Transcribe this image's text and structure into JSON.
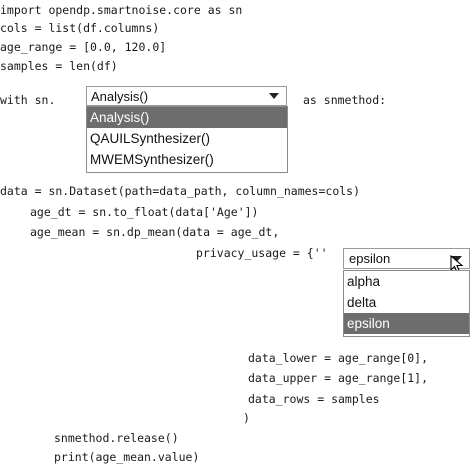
{
  "code": {
    "line1": "import opendp.smartnoise.core as sn",
    "line2": "cols = list(df.columns)",
    "line3": "age_range = [0.0, 120.0]",
    "line4": "samples = len(df)",
    "with_prefix": "with sn.",
    "with_suffix": "as snmethod:",
    "dataset_line": "data = sn.Dataset(path=data_path, column_names=cols)",
    "age_dt_line": "age_dt = sn.to_float(data['Age'])",
    "age_mean_line": "age_mean = sn.dp_mean(data = age_dt,",
    "privacy_prefix": "privacy_usage = {''",
    "data_lower_line": "data_lower = age_range[0],",
    "data_upper_line": "data_upper = age_range[1],",
    "data_rows_line": "data_rows = samples",
    "close_paren": ")",
    "release_line": "snmethod.release()",
    "print_line": "print(age_mean.value)"
  },
  "dropdown1": {
    "selected": "Analysis()",
    "options": [
      "Analysis()",
      "QAUILSynthesizer()",
      "MWEMSynthesizer()"
    ],
    "highlighted_index": 0,
    "arrow_icon": "triangle-down-icon"
  },
  "dropdown2": {
    "selected": "epsilon",
    "options": [
      "alpha",
      "delta",
      "epsilon"
    ],
    "highlighted_index": 2,
    "arrow_icon": "triangle-down-icon",
    "cursor_icon": "mouse-pointer-icon"
  }
}
